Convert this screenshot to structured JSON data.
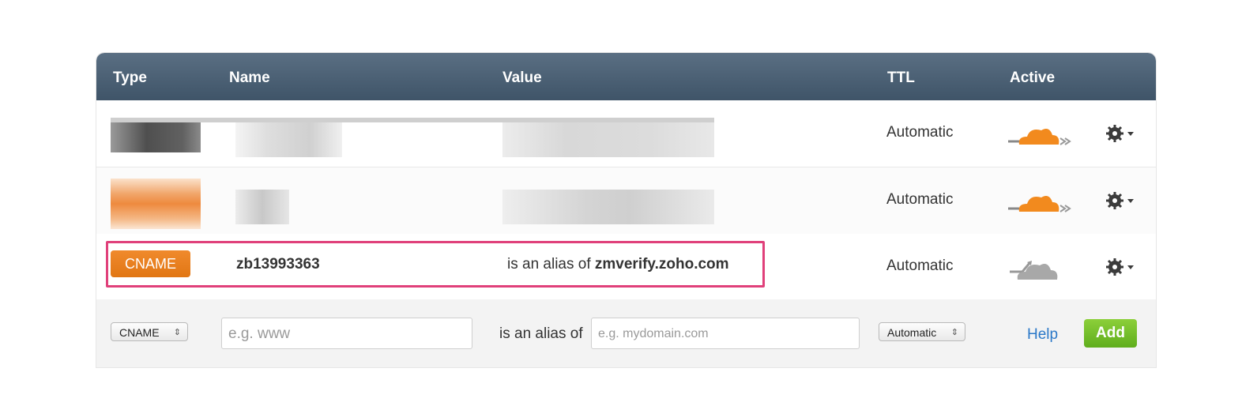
{
  "table": {
    "headers": {
      "type": "Type",
      "name": "Name",
      "value": "Value",
      "ttl": "TTL",
      "active": "Active"
    },
    "rows": [
      {
        "type": "",
        "name": "",
        "value": "",
        "ttl": "Automatic",
        "proxy": "active-cloud-icon"
      },
      {
        "type": "",
        "name": "",
        "value": "",
        "ttl": "Automatic",
        "proxy": "active-cloud-icon"
      },
      {
        "type": "CNAME",
        "name": "zb13993363",
        "value_prefix": "is an alias of",
        "value": "zmverify.zoho.com",
        "ttl": "Automatic",
        "proxy": "inactive-cloud-icon"
      }
    ]
  },
  "form": {
    "type_select": "CNAME",
    "name_placeholder": "e.g. www",
    "alias_label": "is an alias of",
    "value_placeholder": "e.g. mydomain.com",
    "ttl_select": "Automatic",
    "help_label": "Help",
    "add_label": "Add"
  },
  "colors": {
    "header": "#4a5f73",
    "cname_badge": "#e57e1e",
    "highlight_border": "#e0407a",
    "add_button": "#6fbd26",
    "help_link": "#2a78c8"
  }
}
